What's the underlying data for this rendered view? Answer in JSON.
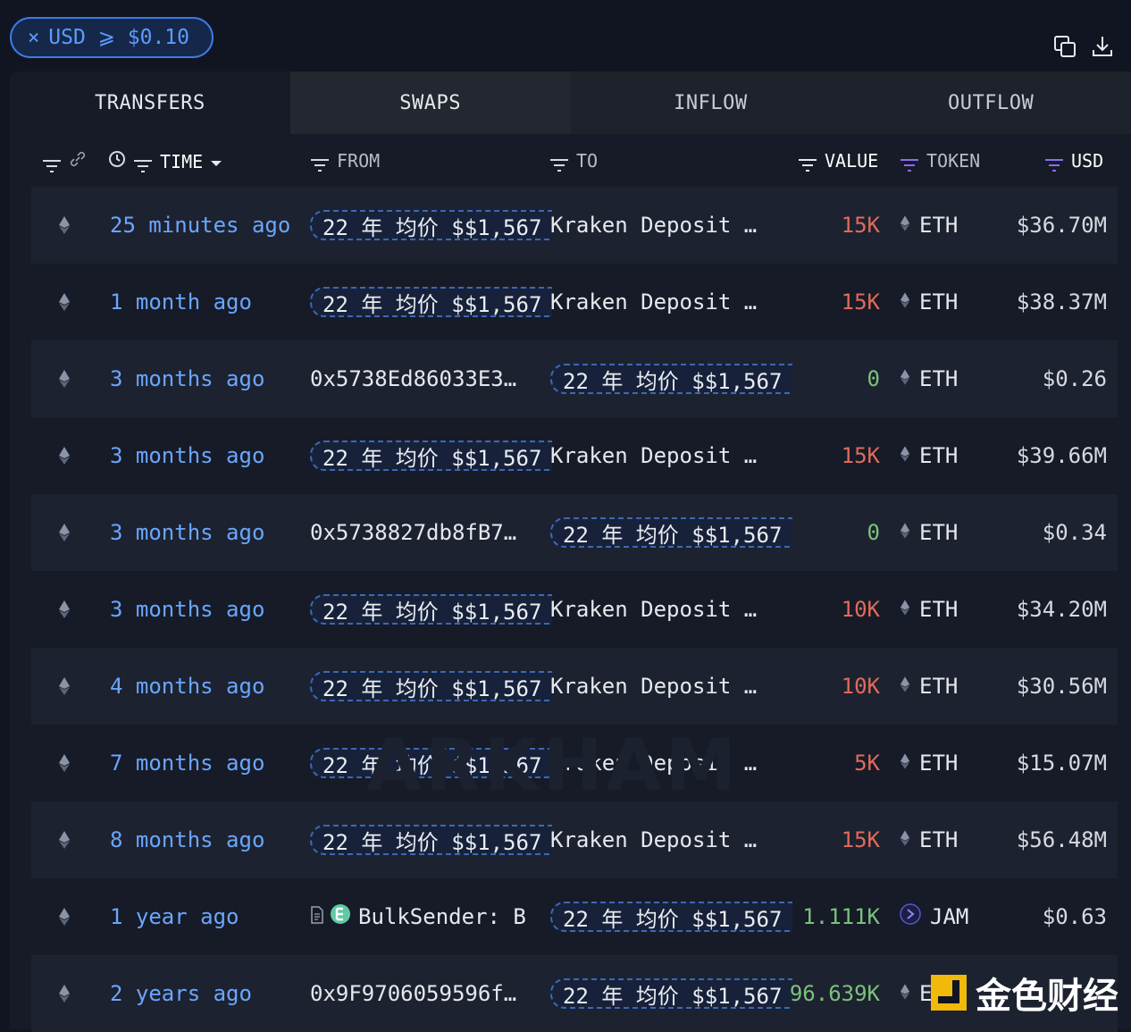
{
  "filter": {
    "close_glyph": "×",
    "label": "USD ⩾ $0.10"
  },
  "tabs": [
    "TRANSFERS",
    "SWAPS",
    "INFLOW",
    "OUTFLOW"
  ],
  "columns": {
    "time": "TIME",
    "from": "FROM",
    "to": "TO",
    "value": "VALUE",
    "token": "TOKEN",
    "usd": "USD"
  },
  "rows": [
    {
      "time": "25 minutes ago",
      "from": "22 年 均价 $$1,567",
      "from_pill": true,
      "to": "Kraken Deposit …",
      "to_pill": false,
      "value": "15K",
      "value_color": "red",
      "token": "ETH",
      "usd": "$36.70M"
    },
    {
      "time": "1 month ago",
      "from": "22 年 均价 $$1,567",
      "from_pill": true,
      "to": "Kraken Deposit …",
      "to_pill": false,
      "value": "15K",
      "value_color": "red",
      "token": "ETH",
      "usd": "$38.37M"
    },
    {
      "time": "3 months ago",
      "from": "0x5738Ed86033E3…",
      "from_pill": false,
      "to": "22 年 均价 $$1,567",
      "to_pill": true,
      "value": "0",
      "value_color": "green",
      "token": "ETH",
      "usd": "$0.26"
    },
    {
      "time": "3 months ago",
      "from": "22 年 均价 $$1,567",
      "from_pill": true,
      "to": "Kraken Deposit …",
      "to_pill": false,
      "value": "15K",
      "value_color": "red",
      "token": "ETH",
      "usd": "$39.66M"
    },
    {
      "time": "3 months ago",
      "from": "0x5738827db8fB7…",
      "from_pill": false,
      "to": "22 年 均价 $$1,567",
      "to_pill": true,
      "value": "0",
      "value_color": "green",
      "token": "ETH",
      "usd": "$0.34"
    },
    {
      "time": "3 months ago",
      "from": "22 年 均价 $$1,567",
      "from_pill": true,
      "to": "Kraken Deposit …",
      "to_pill": false,
      "value": "10K",
      "value_color": "red",
      "token": "ETH",
      "usd": "$34.20M"
    },
    {
      "time": "4 months ago",
      "from": "22 年 均价 $$1,567",
      "from_pill": true,
      "to": "Kraken Deposit …",
      "to_pill": false,
      "value": "10K",
      "value_color": "red",
      "token": "ETH",
      "usd": "$30.56M"
    },
    {
      "time": "7 months ago",
      "from": "22 年 均价 $$1,567",
      "from_pill": true,
      "to": "Kraken Deposit …",
      "to_pill": false,
      "value": "5K",
      "value_color": "red",
      "token": "ETH",
      "usd": "$15.07M"
    },
    {
      "time": "8 months ago",
      "from": "22 年 均价 $$1,567",
      "from_pill": true,
      "to": "Kraken Deposit …",
      "to_pill": false,
      "value": "15K",
      "value_color": "red",
      "token": "ETH",
      "usd": "$56.48M"
    },
    {
      "time": "1 year ago",
      "from": "BulkSender: B",
      "from_pill": false,
      "from_contract": true,
      "to": "22 年 均价 $$1,567",
      "to_pill": true,
      "value": "1.111K",
      "value_color": "green",
      "token": "JAM",
      "usd": "$0.63"
    },
    {
      "time": "2 years ago",
      "from": "0x9F9706059596f…",
      "from_pill": false,
      "to": "22 年 均价 $$1,567",
      "to_pill": true,
      "value": "96.639K",
      "value_color": "green",
      "token": "ETH",
      "usd": ""
    }
  ],
  "watermark": "ARKHAM",
  "brand": {
    "name": "金色财经"
  },
  "colors": {
    "accent": "#3d7be6",
    "time_link": "#6aa6ff",
    "value_red": "#e26a5b",
    "value_green": "#7bc27b"
  }
}
